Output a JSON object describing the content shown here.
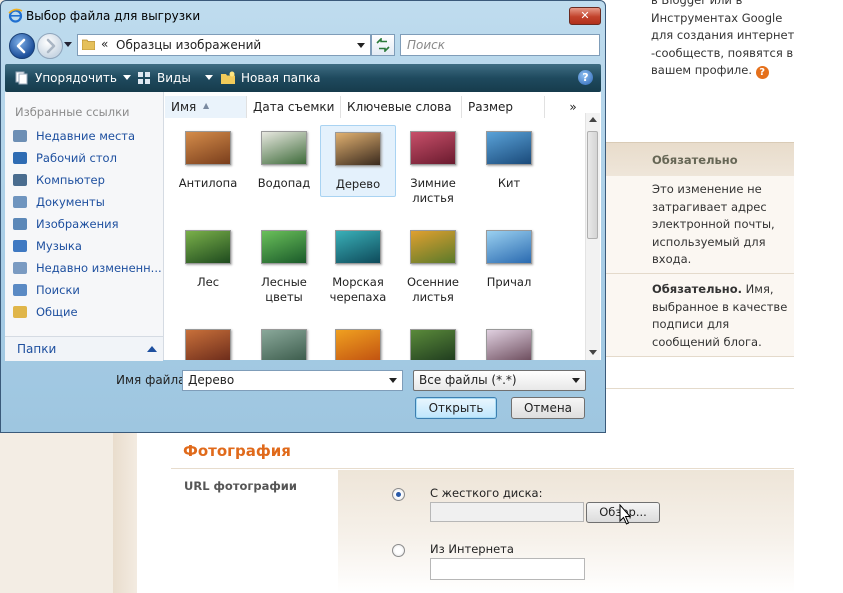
{
  "dialog": {
    "title": "Выбор файла для выгрузки",
    "close_label": "✕",
    "breadcrumb_chevron": "«",
    "address": "Образцы изображений",
    "search_placeholder": "Поиск",
    "toolbar": {
      "organize": "Упорядочить",
      "views": "Виды",
      "new_folder": "Новая папка",
      "help": "?"
    },
    "favorites_title": "Избранные ссылки",
    "favorites": [
      {
        "label": "Недавние места",
        "icon": "recent-places-icon",
        "color": "#6d8fb5"
      },
      {
        "label": "Рабочий стол",
        "icon": "desktop-icon",
        "color": "#2f6cb3"
      },
      {
        "label": "Компьютер",
        "icon": "computer-icon",
        "color": "#4a6d8f"
      },
      {
        "label": "Документы",
        "icon": "documents-icon",
        "color": "#6f95bf"
      },
      {
        "label": "Изображения",
        "icon": "pictures-icon",
        "color": "#5c88b8"
      },
      {
        "label": "Музыка",
        "icon": "music-icon",
        "color": "#3f79c2"
      },
      {
        "label": "Недавно измененн...",
        "icon": "recently-changed-icon",
        "color": "#7a9bc2"
      },
      {
        "label": "Поиски",
        "icon": "searches-icon",
        "color": "#5a8ac4"
      },
      {
        "label": "Общие",
        "icon": "public-folder-icon",
        "color": "#e0b64a"
      }
    ],
    "folders_label": "Папки",
    "columns": [
      "Имя",
      "Дата съемки",
      "Ключевые слова",
      "Размер"
    ],
    "columns_more": "»",
    "sort_indicator": "▲",
    "thumbnails": [
      {
        "label": "Антилопа",
        "c1": "#d48c4a",
        "c2": "#7a3e1c"
      },
      {
        "label": "Водопад",
        "c1": "#e8e8e0",
        "c2": "#3e6b3a"
      },
      {
        "label": "Дерево",
        "c1": "#e0b070",
        "c2": "#3a2a1e"
      },
      {
        "label": "Зимние листья",
        "c1": "#c8506a",
        "c2": "#6a1a2e"
      },
      {
        "label": "Кит",
        "c1": "#5aa2d8",
        "c2": "#1a4a7a"
      },
      {
        "label": "Лес",
        "c1": "#7ab04a",
        "c2": "#1e4a1e"
      },
      {
        "label": "Лесные цветы",
        "c1": "#6ac05a",
        "c2": "#1a5a2a"
      },
      {
        "label": "Морская черепаха",
        "c1": "#3ab0b8",
        "c2": "#0e4a5a"
      },
      {
        "label": "Осенние листья",
        "c1": "#e0a030",
        "c2": "#5a7a2a"
      },
      {
        "label": "Причал",
        "c1": "#9ad0f0",
        "c2": "#2a6ab0"
      },
      {
        "label": "",
        "c1": "#c8703a",
        "c2": "#6a2a1a"
      },
      {
        "label": "",
        "c1": "#8aa89a",
        "c2": "#3a5a4a"
      },
      {
        "label": "",
        "c1": "#f0a020",
        "c2": "#c05010"
      },
      {
        "label": "",
        "c1": "#5a8a3a",
        "c2": "#1e3a1e"
      },
      {
        "label": "",
        "c1": "#e0d0e0",
        "c2": "#6a4a5a"
      }
    ],
    "selected_index": 2,
    "filename_label": "Имя файла:",
    "filename_value": "Дерево",
    "filetype_value": "Все файлы (*.*)",
    "open_label": "Открыть",
    "cancel_label": "Отмена"
  },
  "page": {
    "intro_lines": [
      "в Blogger или в",
      "Инструментах Google",
      "для создания интернет",
      "-сообществ, появятся в",
      "вашем профиле."
    ],
    "help_badge": "?",
    "required_header": "Обязательно",
    "email_note": [
      "Это изменение не",
      "затрагивает адрес",
      "электронной почты,",
      "используемый для",
      "входа."
    ],
    "name_note_bold": "Обязательно.",
    "name_note_rest": [
      "Имя,",
      "выбранное в качестве",
      "подписи для",
      "сообщений блога."
    ],
    "photo_section_title": "Фотография",
    "photo_url_label": "URL фотографии",
    "from_disk_label": "С жесткого диска:",
    "browse_label": "Обзор...",
    "from_internet_label": "Из Интернета",
    "accent_color": "#e06a1b"
  }
}
